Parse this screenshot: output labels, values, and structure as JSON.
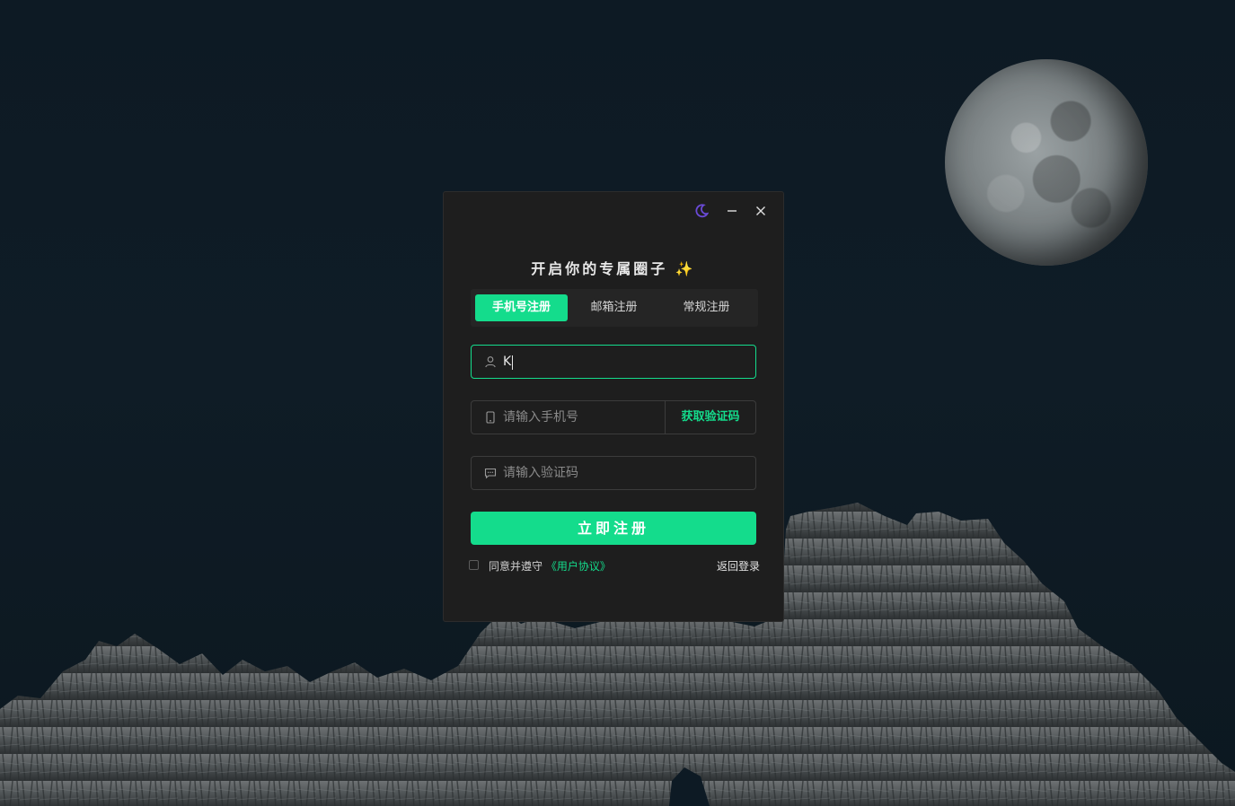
{
  "window": {
    "title": "开启你的专属圈子 ✨",
    "controls": {
      "theme": "moon-icon",
      "minimize": "minimize-icon",
      "close": "close-icon"
    }
  },
  "tabs": [
    {
      "label": "手机号注册",
      "active": true
    },
    {
      "label": "邮箱注册",
      "active": false
    },
    {
      "label": "常规注册",
      "active": false
    }
  ],
  "form": {
    "username": {
      "value": "K",
      "placeholder": "",
      "icon": "user-icon"
    },
    "phone": {
      "value": "",
      "placeholder": "请输入手机号",
      "icon": "phone-icon"
    },
    "get_code_label": "获取验证码",
    "code": {
      "value": "",
      "placeholder": "请输入验证码",
      "icon": "message-icon"
    },
    "submit_label": "立即注册"
  },
  "agreement": {
    "prefix": "同意并遵守",
    "link": "《用户协议》",
    "checked": false
  },
  "back_label": "返回登录",
  "colors": {
    "accent": "#14dc8c",
    "panel": "#1e1e1e",
    "moon_icon": "#6a4ad6"
  }
}
